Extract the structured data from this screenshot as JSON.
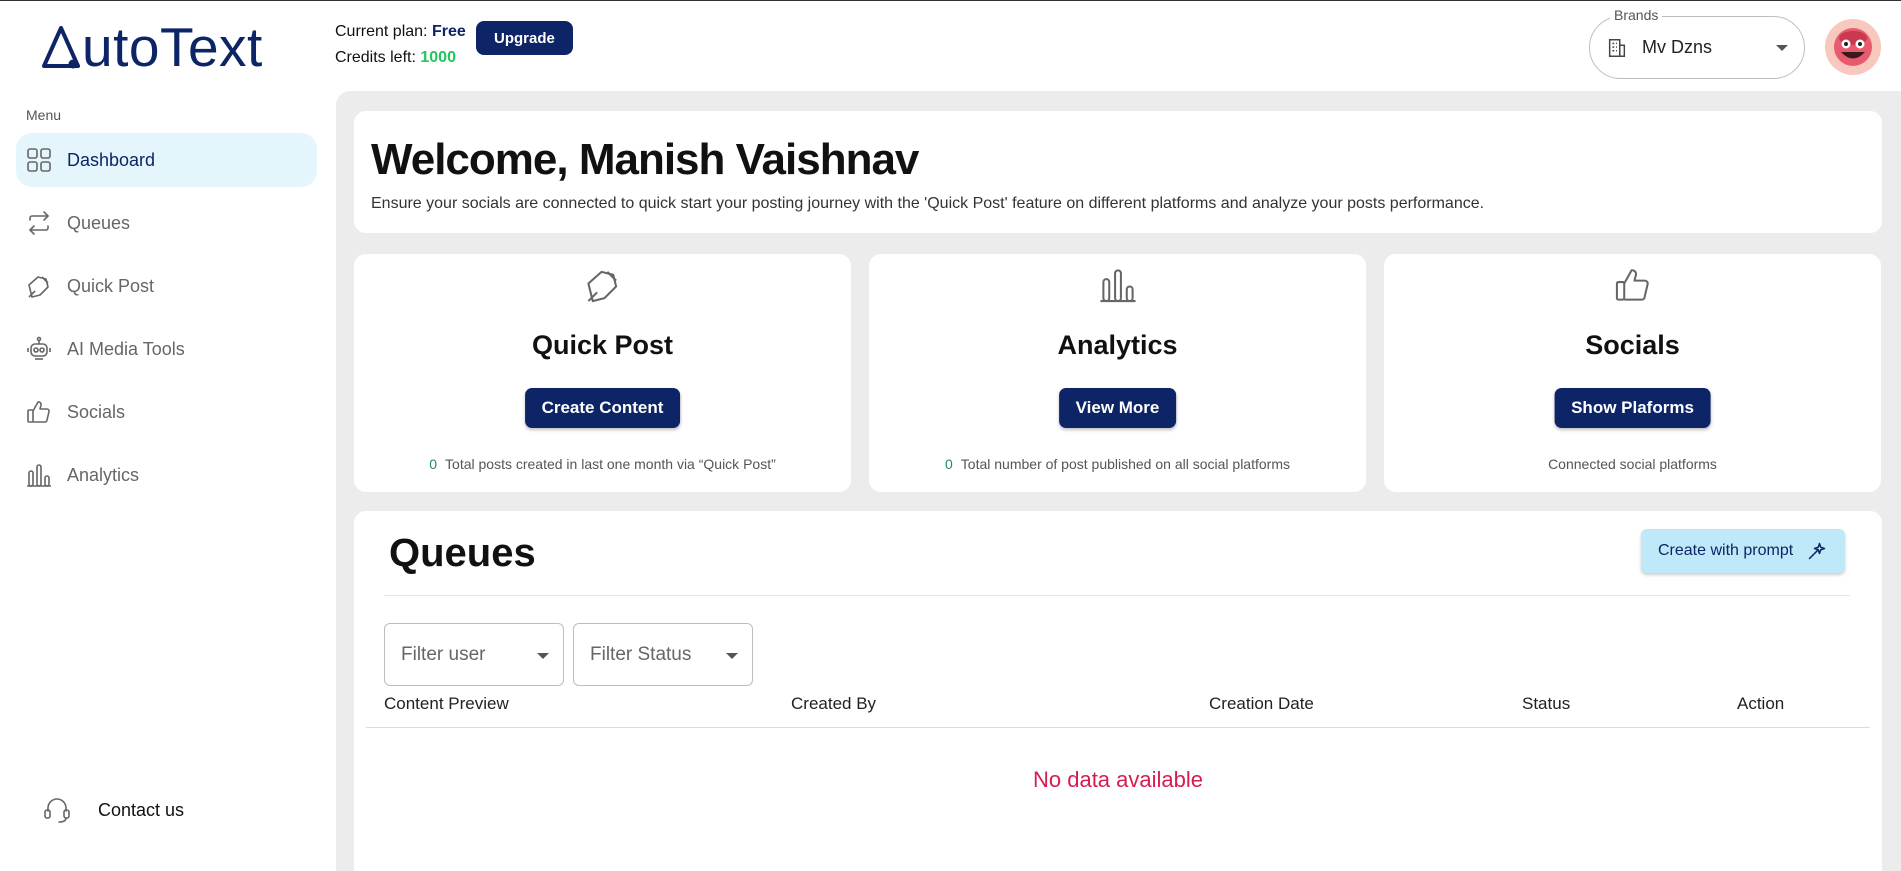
{
  "brand": {
    "logo_text": "utoText",
    "logo_full": "AutoText"
  },
  "plan": {
    "current_label": "Current plan:",
    "current_value": "Free",
    "credits_label": "Credits left:",
    "credits_value": "1000",
    "upgrade_label": "Upgrade"
  },
  "brands_select": {
    "legend": "Brands",
    "value": "Mv Dzns"
  },
  "sidebar": {
    "menu_label": "Menu",
    "items": [
      {
        "label": "Dashboard",
        "icon": "grid-icon",
        "active": true
      },
      {
        "label": "Queues",
        "icon": "repeat-icon",
        "active": false
      },
      {
        "label": "Quick Post",
        "icon": "edit-icon",
        "active": false
      },
      {
        "label": "AI Media Tools",
        "icon": "robot-icon",
        "active": false
      },
      {
        "label": "Socials",
        "icon": "thumbs-up-icon",
        "active": false
      },
      {
        "label": "Analytics",
        "icon": "bar-chart-icon",
        "active": false
      }
    ],
    "contact_label": "Contact us"
  },
  "welcome": {
    "title": "Welcome, Manish Vaishnav",
    "subtitle": "Ensure your socials are connected to quick start your posting journey with the 'Quick Post' feature on different platforms and analyze your posts performance."
  },
  "features": [
    {
      "title": "Quick Post",
      "button": "Create Content",
      "count": "0",
      "note": "Total posts created in last one month via “Quick Post”",
      "icon": "edit-icon"
    },
    {
      "title": "Analytics",
      "button": "View More",
      "count": "0",
      "note": "Total number of post published on all social platforms",
      "icon": "bar-chart-icon"
    },
    {
      "title": "Socials",
      "button": "Show Plaforms",
      "count": "",
      "note": "Connected social platforms",
      "icon": "thumbs-up-icon"
    }
  ],
  "queues": {
    "title": "Queues",
    "create_prompt_label": "Create with prompt",
    "filter_user_placeholder": "Filter user",
    "filter_status_placeholder": "Filter Status",
    "columns": [
      "Content Preview",
      "Created By",
      "Creation Date",
      "Status",
      "Action"
    ],
    "empty_message": "No data available"
  },
  "colors": {
    "primary": "#0d2567",
    "accent_light": "#bfe8f8",
    "success": "#22c55e",
    "error": "#d81b50"
  }
}
